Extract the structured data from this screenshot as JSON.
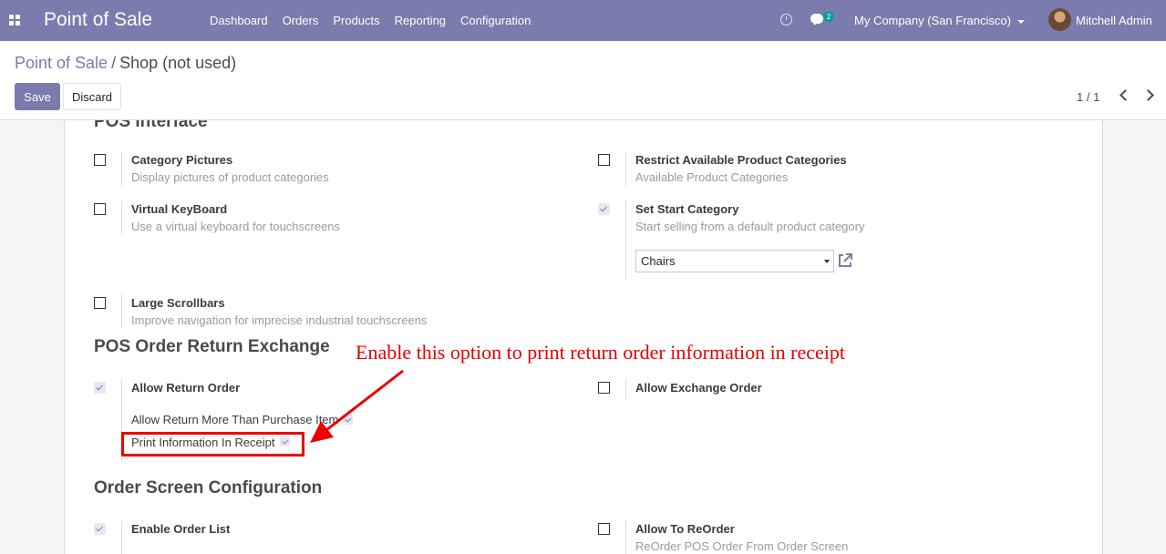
{
  "navbar": {
    "app_name": "Point of Sale",
    "menu": [
      "Dashboard",
      "Orders",
      "Products",
      "Reporting",
      "Configuration"
    ],
    "message_count": "2",
    "company": "My Company (San Francisco)",
    "user": "Mitchell Admin"
  },
  "breadcrumb": {
    "parent": "Point of Sale",
    "separator": "/",
    "current": "Shop (not used)"
  },
  "buttons": {
    "save": "Save",
    "discard": "Discard"
  },
  "pager": {
    "value": "1 / 1"
  },
  "sections": {
    "pos_interface": {
      "title": "POS Interface",
      "category_pictures": {
        "title": "Category Pictures",
        "desc": "Display pictures of product categories",
        "checked": false
      },
      "restrict_categories": {
        "title": "Restrict Available Product Categories",
        "desc": "Available Product Categories",
        "checked": false
      },
      "virtual_keyboard": {
        "title": "Virtual KeyBoard",
        "desc": "Use a virtual keyboard for touchscreens",
        "checked": false
      },
      "start_category": {
        "title": "Set Start Category",
        "desc": "Start selling from a default product category",
        "checked": true,
        "selected": "Chairs"
      },
      "large_scrollbars": {
        "title": "Large Scrollbars",
        "desc": "Improve navigation for imprecise industrial touchscreens",
        "checked": false
      }
    },
    "return_exchange": {
      "title": "POS Order Return Exchange",
      "allow_return": {
        "title": "Allow Return Order",
        "checked": true
      },
      "allow_more_than_purchase": {
        "label": "Allow Return More Than Purchase Item",
        "checked": true
      },
      "print_info_receipt": {
        "label": "Print Information In Receipt",
        "checked": true
      },
      "allow_exchange": {
        "title": "Allow Exchange Order",
        "checked": false
      }
    },
    "order_screen": {
      "title": "Order Screen Configuration",
      "enable_order_list": {
        "title": "Enable Order List",
        "checked": true
      },
      "allow_reorder": {
        "title": "Allow To ReOrder",
        "desc": "ReOrder POS Order From Order Screen",
        "checked": false
      }
    }
  },
  "annotation": {
    "text": "Enable this option to print return order information in receipt",
    "color": "#e60000"
  },
  "colors": {
    "brand": "#7c7bad",
    "badge": "#00a09d"
  }
}
